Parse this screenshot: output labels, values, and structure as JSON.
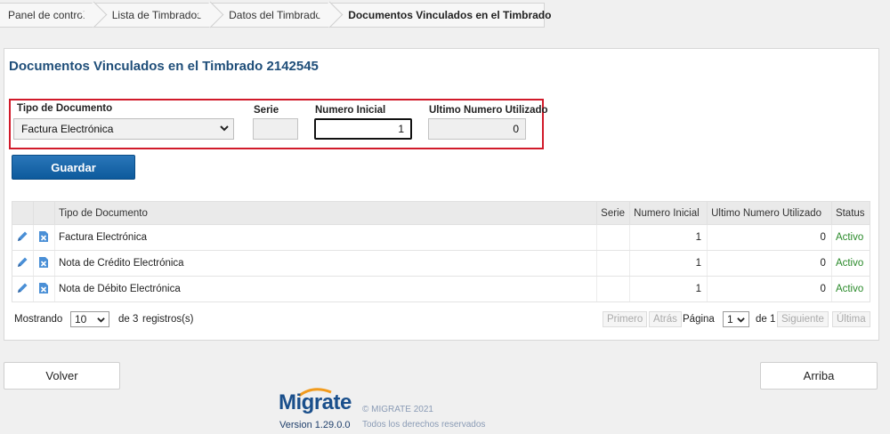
{
  "breadcrumb": {
    "items": [
      "Panel de control",
      "Lista de Timbrados",
      "Datos del Timbrado",
      "Documentos Vinculados en el Timbrado"
    ]
  },
  "page": {
    "title": "Documentos Vinculados en el Timbrado 2142545"
  },
  "form": {
    "tipo_label": "Tipo de Documento",
    "tipo_value": "Factura Electrónica",
    "serie_label": "Serie",
    "serie_value": "",
    "numero_inicial_label": "Numero Inicial",
    "numero_inicial_value": "1",
    "ultimo_label": "Ultimo Numero Utilizado",
    "ultimo_value": "0",
    "save_label": "Guardar"
  },
  "table": {
    "headers": [
      "Tipo de Documento",
      "Serie",
      "Numero Inicial",
      "Ultimo Numero Utilizado",
      "Status"
    ],
    "rows": [
      {
        "tipo": "Factura Electrónica",
        "serie": "",
        "inicial": "1",
        "ultimo": "0",
        "status": "Activo"
      },
      {
        "tipo": "Nota de Crédito Electrónica",
        "serie": "",
        "inicial": "1",
        "ultimo": "0",
        "status": "Activo"
      },
      {
        "tipo": "Nota de Débito Electrónica",
        "serie": "",
        "inicial": "1",
        "ultimo": "0",
        "status": "Activo"
      }
    ]
  },
  "pager": {
    "showing_label": "Mostrando",
    "page_size": "10",
    "of_label": "de",
    "total": "3",
    "records_label": "registros(s)",
    "first": "Primero",
    "prev": "Atrás",
    "page_label": "Página",
    "page": "1",
    "page_of": "de",
    "page_total": "1",
    "next": "Siguiente",
    "last": "Última"
  },
  "actions": {
    "back_label": "Volver",
    "top_label": "Arriba"
  },
  "footer": {
    "logo": "Migrate",
    "version": "Version  1.29.0.0",
    "copyright": "© MIGRATE 2021",
    "rights": "Todos los derechos reservados"
  },
  "colors": {
    "accent": "#1f4e79",
    "button": "#0d5a9c",
    "highlight_border": "#d11a2a",
    "status_active": "#2a8a2a"
  },
  "icons": [
    "pencil-icon",
    "delete-file-icon",
    "chevron-down-icon"
  ]
}
